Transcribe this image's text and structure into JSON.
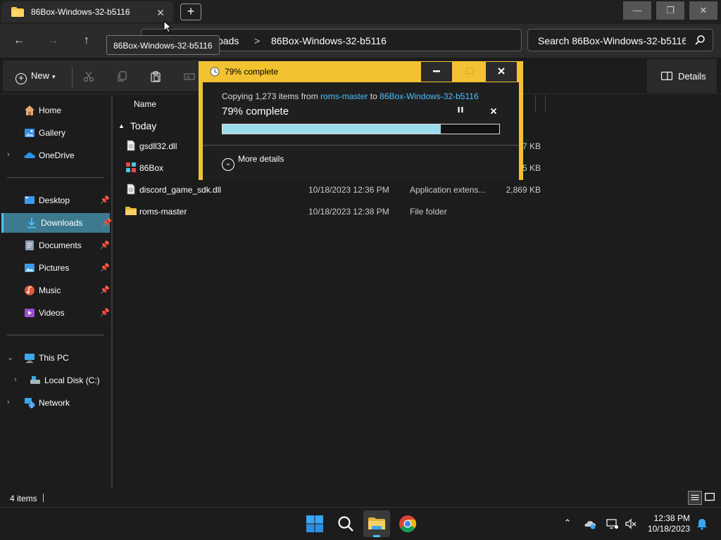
{
  "window": {
    "tab_title": "86Box-Windows-32-b5116",
    "tab_close": "✕",
    "new_tab": "+",
    "minimize": "—",
    "restore": "❐",
    "close": "✕"
  },
  "address": {
    "crumbs": [
      "oads",
      "86Box-Windows-32-b5116"
    ],
    "separator": ">",
    "search_placeholder": "Search 86Box-Windows-32-b5116",
    "tooltip": "86Box-Windows-32-b5116"
  },
  "nav_buttons": {
    "back": "←",
    "forward": "→",
    "up": "↑"
  },
  "commandbar": {
    "new_label": "New",
    "details_label": "Details"
  },
  "sidebar": {
    "quick": [
      {
        "label": "Home",
        "icon": "home-icon"
      },
      {
        "label": "Gallery",
        "icon": "gallery-icon"
      },
      {
        "label": "OneDrive",
        "icon": "onedrive-icon"
      }
    ],
    "pinned": [
      {
        "label": "Desktop",
        "icon": "desktop-icon"
      },
      {
        "label": "Downloads",
        "icon": "downloads-icon",
        "active": true
      },
      {
        "label": "Documents",
        "icon": "documents-icon"
      },
      {
        "label": "Pictures",
        "icon": "pictures-icon"
      },
      {
        "label": "Music",
        "icon": "music-icon"
      },
      {
        "label": "Videos",
        "icon": "videos-icon"
      }
    ],
    "devices": [
      {
        "label": "This PC",
        "icon": "this-pc-icon"
      },
      {
        "label": "Local Disk (C:)",
        "icon": "local-disk-icon"
      },
      {
        "label": "Network",
        "icon": "network-icon"
      }
    ]
  },
  "filelist": {
    "column_name": "Name",
    "group_label": "Today",
    "rows": [
      {
        "name": "gsdll32.dll",
        "date": "",
        "type": "",
        "size": "7 KB",
        "icon": "dll-file-icon"
      },
      {
        "name": "86Box",
        "date": "",
        "type": "",
        "size": "5 KB",
        "icon": "app-icon"
      },
      {
        "name": "discord_game_sdk.dll",
        "date": "10/18/2023 12:36 PM",
        "type": "Application extens...",
        "size": "2,869 KB",
        "icon": "dll-file-icon"
      },
      {
        "name": "roms-master",
        "date": "10/18/2023 12:38 PM",
        "type": "File folder",
        "size": "",
        "icon": "folder-icon"
      }
    ]
  },
  "status": {
    "item_count": "4 items"
  },
  "dialog": {
    "title": "79% complete",
    "copy_prefix": "Copying 1,273 items from ",
    "source": "roms-master",
    "copy_to": " to ",
    "destination": "86Box-Windows-32-b5116",
    "percent_label": "79% complete",
    "progress": 0.79,
    "more_details": "More details",
    "accent_color": "#f2c232",
    "progress_color": "#9bdcec"
  },
  "taskbar": {
    "time": "12:38 PM",
    "date": "10/18/2023"
  },
  "colors": {
    "link": "#4cc2ff",
    "selection": "#3d7a90"
  }
}
